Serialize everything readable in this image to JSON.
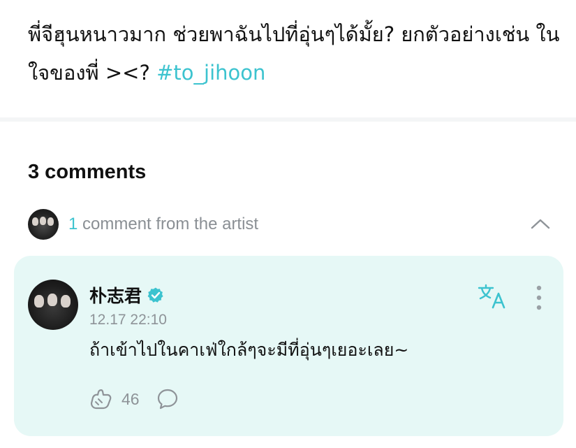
{
  "post": {
    "text": "พี่จีฮุนหนาวมาก ช่วยพาฉันไปที่อุ่นๆได้มั้ย? ยกตัวอย่างเช่น ในใจของพี่ ><? ",
    "hashtag": "#to_jihoon"
  },
  "comments": {
    "count_label": "3 comments",
    "artist_count": "1",
    "artist_label": " comment from the artist"
  },
  "artist_comment": {
    "author": "朴志君",
    "timestamp": "12.17 22:10",
    "body": "ถ้าเข้าไปในคาเฟ่ใกล้ๆจะมีที่อุ่นๆเยอะเลย~",
    "likes": "46"
  },
  "colors": {
    "accent": "#3cc3cf",
    "card_bg": "#e6f8f6",
    "muted": "#8e9398"
  },
  "icons": [
    "chevron-up-icon",
    "verified-icon",
    "translate-icon",
    "more-icon",
    "like-icon",
    "reply-icon"
  ]
}
